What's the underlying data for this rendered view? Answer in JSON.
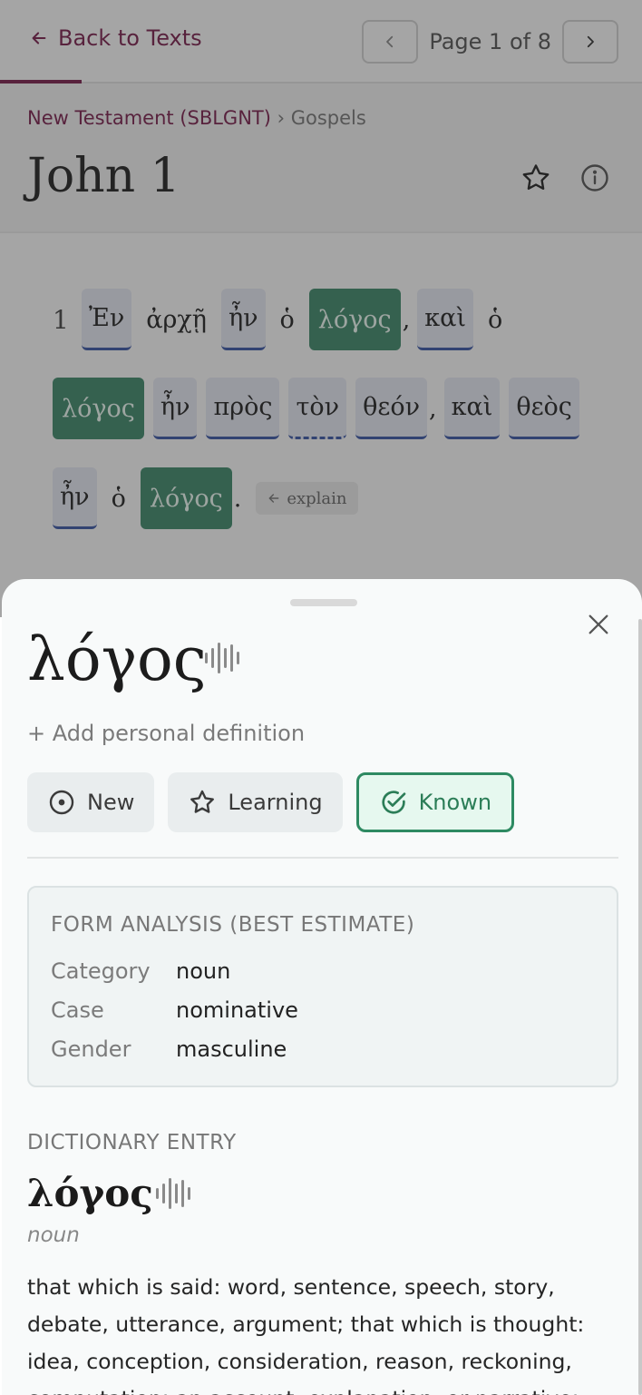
{
  "nav": {
    "back_label": "Back to Texts",
    "page_label": "Page 1 of 8"
  },
  "header": {
    "breadcrumb_collection": "New Testament (SBLGNT)",
    "breadcrumb_separator": "›",
    "breadcrumb_section": "Gospels",
    "title": "John 1"
  },
  "reader": {
    "verse_number": "1",
    "explain_label": "explain",
    "tokens": [
      {
        "text": "Ἐν",
        "status": "new"
      },
      {
        "text": "ἀρχῇ",
        "status": "plain"
      },
      {
        "text": "ἦν",
        "status": "new"
      },
      {
        "text": "ὁ",
        "status": "plain"
      },
      {
        "text": "λόγος",
        "status": "known"
      },
      {
        "text": ",",
        "status": "punct"
      },
      {
        "text": "καὶ",
        "status": "new"
      },
      {
        "text": "ὁ",
        "status": "plain"
      },
      {
        "text": "λόγος",
        "status": "known"
      },
      {
        "text": "ἦν",
        "status": "new"
      },
      {
        "text": "πρὸς",
        "status": "new"
      },
      {
        "text": "τὸν",
        "status": "dashed"
      },
      {
        "text": "θεόν",
        "status": "new"
      },
      {
        "text": ",",
        "status": "punct"
      },
      {
        "text": "καὶ",
        "status": "new"
      },
      {
        "text": "θεὸς",
        "status": "new"
      },
      {
        "text": "ἦν",
        "status": "new"
      },
      {
        "text": "ὁ",
        "status": "plain"
      },
      {
        "text": "λόγος",
        "status": "known"
      },
      {
        "text": ".",
        "status": "punct"
      }
    ]
  },
  "sheet": {
    "word": "λόγος",
    "add_definition": "+ Add personal definition",
    "status_buttons": [
      {
        "label": "New",
        "icon": "circle-dot-icon"
      },
      {
        "label": "Learning",
        "icon": "star-icon"
      },
      {
        "label": "Known",
        "icon": "check-circle-icon"
      }
    ],
    "selected_status": "Known",
    "analysis": {
      "heading": "FORM ANALYSIS (BEST ESTIMATE)",
      "rows": [
        {
          "key": "Category",
          "value": "noun"
        },
        {
          "key": "Case",
          "value": "nominative"
        },
        {
          "key": "Gender",
          "value": "masculine"
        }
      ]
    },
    "dictionary": {
      "heading": "DICTIONARY ENTRY",
      "lemma": "λόγος",
      "pos": "noun",
      "definition": "that which is said: word, sentence, speech, story, debate, utterance, argument; that which is thought: idea, conception, consideration, reason, reckoning, computation; an account, explanation, or narrative;"
    }
  },
  "colors": {
    "accent": "#7a1e4d",
    "known": "#3f8a6c",
    "new_underline": "#3a56a8"
  }
}
